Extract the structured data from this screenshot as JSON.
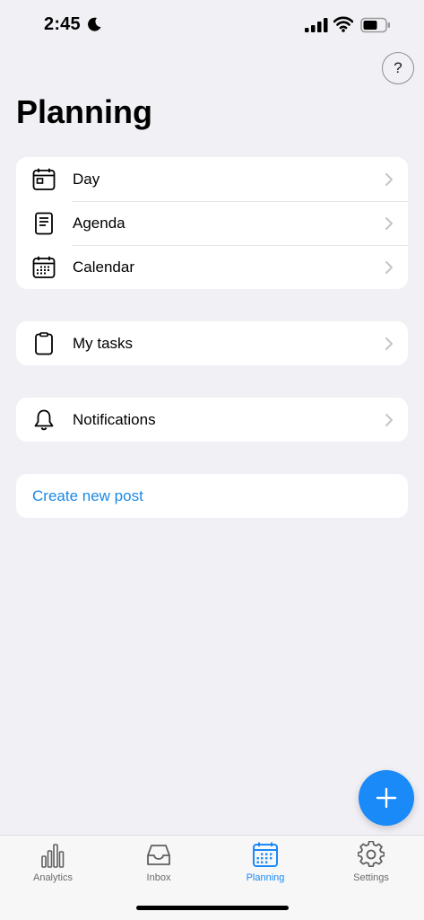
{
  "status_bar": {
    "time": "2:45"
  },
  "header": {
    "title": "Planning",
    "help_label": "?"
  },
  "groups": [
    {
      "items": [
        {
          "label": "Day",
          "icon": "day-calendar-icon"
        },
        {
          "label": "Agenda",
          "icon": "agenda-document-icon"
        },
        {
          "label": "Calendar",
          "icon": "calendar-grid-icon"
        }
      ]
    },
    {
      "items": [
        {
          "label": "My tasks",
          "icon": "clipboard-icon"
        }
      ]
    },
    {
      "items": [
        {
          "label": "Notifications",
          "icon": "bell-icon"
        }
      ]
    }
  ],
  "actions": {
    "create_post": "Create new post"
  },
  "fab": {
    "icon": "plus-icon"
  },
  "tab_bar": {
    "tabs": [
      {
        "label": "Analytics",
        "icon": "bar-chart-icon"
      },
      {
        "label": "Inbox",
        "icon": "inbox-tray-icon"
      },
      {
        "label": "Planning",
        "icon": "calendar-grid-icon",
        "active": true
      },
      {
        "label": "Settings",
        "icon": "gear-icon"
      }
    ]
  },
  "colors": {
    "accent": "#1a8af8",
    "link": "#1a8ae6",
    "background": "#f1f0f5"
  }
}
